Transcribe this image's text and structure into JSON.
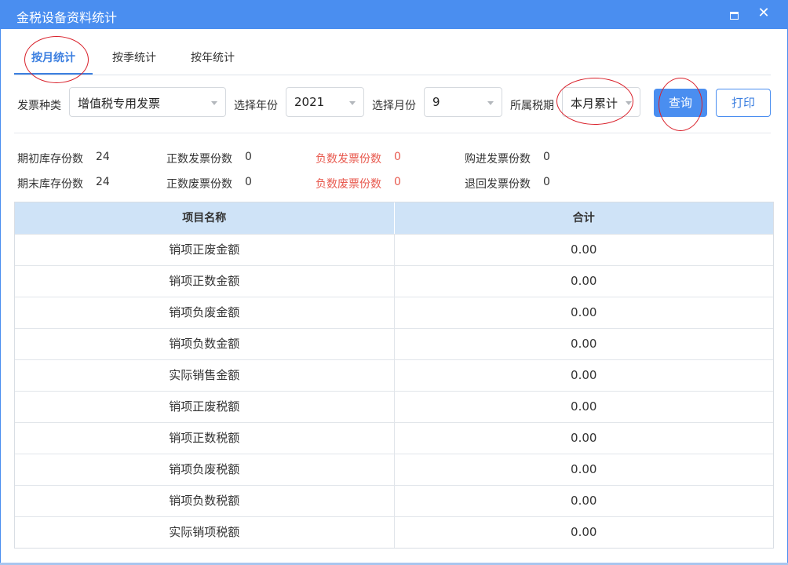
{
  "window": {
    "title": "金税设备资料统计",
    "maximize_icon": "maximize-icon",
    "close_icon": "close-icon",
    "close_glyph": "✕",
    "accent_color": "#4a8ef0",
    "warning_color": "#e85a4f"
  },
  "tabs": [
    {
      "label": "按月统计",
      "active": true
    },
    {
      "label": "按季统计",
      "active": false
    },
    {
      "label": "按年统计",
      "active": false
    }
  ],
  "filters": {
    "invoice_type_label": "发票种类",
    "invoice_type_value": "增值税专用发票",
    "year_label": "选择年份",
    "year_value": "2021",
    "month_label": "选择月份",
    "month_value": "9",
    "period_label": "所属税期",
    "period_value": "本月累计",
    "query_button": "查询",
    "print_button": "打印"
  },
  "stats": {
    "opening_stock_label": "期初库存份数",
    "opening_stock_value": "24",
    "positive_issued_label": "正数发票份数",
    "positive_issued_value": "0",
    "negative_issued_label": "负数发票份数",
    "negative_issued_value": "0",
    "purchased_label": "购进发票份数",
    "purchased_value": "0",
    "closing_stock_label": "期末库存份数",
    "closing_stock_value": "24",
    "positive_void_label": "正数废票份数",
    "positive_void_value": "0",
    "negative_void_label": "负数废票份数",
    "negative_void_value": "0",
    "returned_label": "退回发票份数",
    "returned_value": "0"
  },
  "table": {
    "headers": [
      "项目名称",
      "合计"
    ],
    "rows": [
      {
        "name": "销项正废金额",
        "total": "0.00"
      },
      {
        "name": "销项正数金额",
        "total": "0.00"
      },
      {
        "name": "销项负废金额",
        "total": "0.00"
      },
      {
        "name": "销项负数金额",
        "total": "0.00"
      },
      {
        "name": "实际销售金额",
        "total": "0.00"
      },
      {
        "name": "销项正废税额",
        "total": "0.00"
      },
      {
        "name": "销项正数税额",
        "total": "0.00"
      },
      {
        "name": "销项负废税额",
        "total": "0.00"
      },
      {
        "name": "销项负数税额",
        "total": "0.00"
      },
      {
        "name": "实际销项税额",
        "total": "0.00"
      }
    ]
  }
}
